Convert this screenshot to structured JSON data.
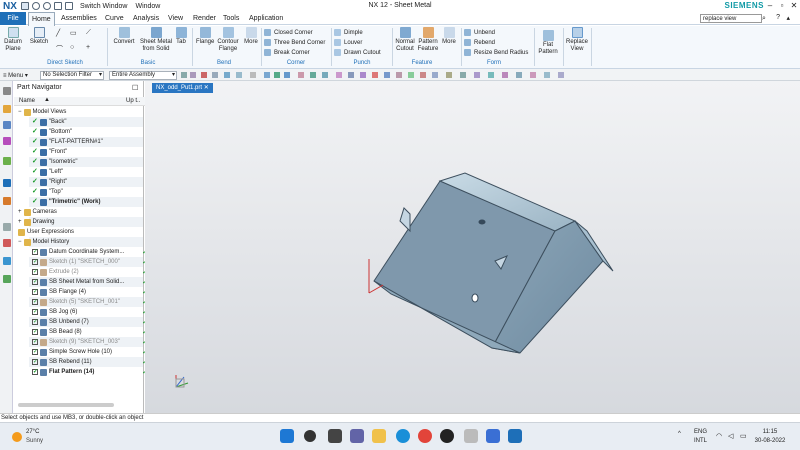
{
  "titlebar": {
    "app_logo": "NX",
    "title": "NX 12 - Sheet Metal",
    "switch_window": "Switch Window",
    "window_menu": "Window",
    "brand": "SIEMENS"
  },
  "tabs": {
    "file": "File",
    "items": [
      "Home",
      "Assemblies",
      "Curve",
      "Analysis",
      "View",
      "Render",
      "Tools",
      "Application"
    ],
    "active": "Home"
  },
  "search": {
    "value": "replace view"
  },
  "ribbon": {
    "datum_plane": "Datum\nPlane",
    "sketch": "Sketch",
    "convert": "Convert",
    "sheet_metal": "Sheet Metal\nfrom Solid",
    "tab": "Tab",
    "flange": "Flange",
    "contour_flange": "Contour\nFlange",
    "more1": "More",
    "corner_items": [
      "Closed Corner",
      "Three Bend Corner",
      "Break Corner"
    ],
    "punch_items": [
      "Dimple",
      "Louver",
      "Drawn Cutout"
    ],
    "normal_cutout": "Normal\nCutout",
    "pattern_feature": "Pattern\nFeature",
    "more2": "More",
    "form_items": [
      "Unbend",
      "Rebend",
      "Resize Bend Radius"
    ],
    "flat_pattern": "Flat\nPattern",
    "replace_view": "Replace\nView",
    "groups": [
      "Direct Sketch",
      "Basic",
      "Bend",
      "Corner",
      "Punch",
      "Feature",
      "Form"
    ]
  },
  "cmdrow": {
    "menu": "Menu",
    "selection_filter": "No Selection Filter",
    "assembly_scope": "Entire Assembly"
  },
  "navigator": {
    "title": "Part Navigator",
    "col_name": "Name",
    "col_uptodate": "Up t..",
    "rows": [
      {
        "label": "Model Views",
        "indent": 0,
        "kind": "group"
      },
      {
        "label": "\"Back\"",
        "indent": 2,
        "kind": "view"
      },
      {
        "label": "\"Bottom\"",
        "indent": 2,
        "kind": "view"
      },
      {
        "label": "\"FLAT-PATTERN#1\"",
        "indent": 2,
        "kind": "view"
      },
      {
        "label": "\"Front\"",
        "indent": 2,
        "kind": "view"
      },
      {
        "label": "\"Isometric\"",
        "indent": 2,
        "kind": "view"
      },
      {
        "label": "\"Left\"",
        "indent": 2,
        "kind": "view"
      },
      {
        "label": "\"Right\"",
        "indent": 2,
        "kind": "view"
      },
      {
        "label": "\"Top\"",
        "indent": 2,
        "kind": "view"
      },
      {
        "label": "\"Trimetric\" (Work)",
        "indent": 2,
        "kind": "view",
        "bold": true
      },
      {
        "label": "Cameras",
        "indent": 0,
        "kind": "group"
      },
      {
        "label": "Drawing",
        "indent": 0,
        "kind": "group"
      },
      {
        "label": "User Expressions",
        "indent": 0,
        "kind": "plain"
      },
      {
        "label": "Model History",
        "indent": 0,
        "kind": "group"
      },
      {
        "label": "Datum Coordinate System...",
        "indent": 2,
        "kind": "feat",
        "ok": true
      },
      {
        "label": "Sketch (1) \"SKETCH_000\"",
        "indent": 2,
        "kind": "feat",
        "grey": true,
        "ok": true
      },
      {
        "label": "Extrude (2)",
        "indent": 2,
        "kind": "feat",
        "grey": true,
        "ok": true
      },
      {
        "label": "SB Sheet Metal from Solid...",
        "indent": 2,
        "kind": "feat",
        "ok": true
      },
      {
        "label": "SB Flange (4)",
        "indent": 2,
        "kind": "feat",
        "ok": true
      },
      {
        "label": "Sketch (5) \"SKETCH_001\"",
        "indent": 2,
        "kind": "feat",
        "grey": true,
        "ok": true
      },
      {
        "label": "SB Jog (6)",
        "indent": 2,
        "kind": "feat",
        "ok": true
      },
      {
        "label": "SB Unbend (7)",
        "indent": 2,
        "kind": "feat",
        "ok": true
      },
      {
        "label": "SB Bead (8)",
        "indent": 2,
        "kind": "feat",
        "ok": true
      },
      {
        "label": "Sketch (9) \"SKETCH_003\"",
        "indent": 2,
        "kind": "feat",
        "grey": true,
        "ok": true
      },
      {
        "label": "Simple Screw Hole (10)",
        "indent": 2,
        "kind": "feat",
        "ok": true
      },
      {
        "label": "SB Rebend (11)",
        "indent": 2,
        "kind": "feat",
        "ok": true
      },
      {
        "label": "Flat Pattern (14)",
        "indent": 2,
        "kind": "feat",
        "bold": true,
        "ok": true
      }
    ]
  },
  "graphics": {
    "tab_label": "NX_odd_Put1.prt"
  },
  "status": {
    "message": "Select objects and use MB3, or double-click an object"
  },
  "taskbar": {
    "temperature": "27°C",
    "weather": "Sunny",
    "lang": "ENG",
    "kbd": "INTL",
    "time": "11:15",
    "date": "30-08-2022"
  },
  "colors": {
    "accent": "#1e6fb8",
    "brand": "#109aa6",
    "check": "#1a9a2a"
  }
}
